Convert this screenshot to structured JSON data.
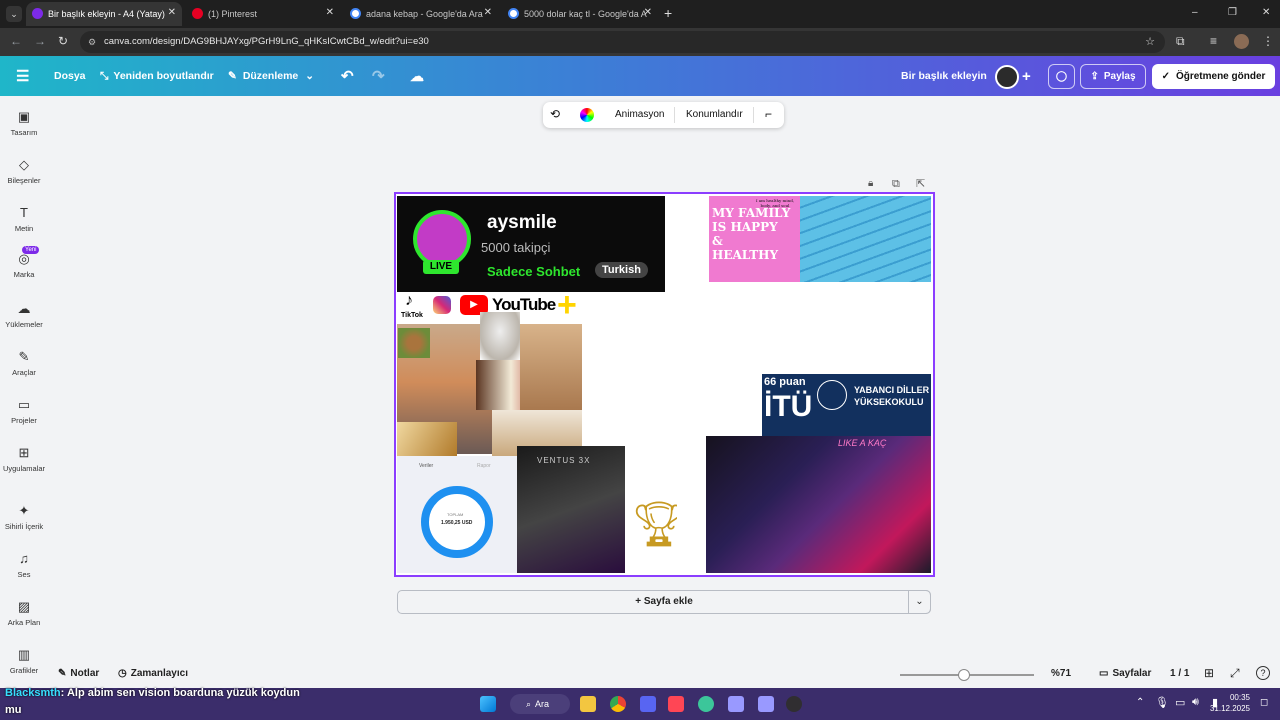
{
  "browser": {
    "tabs": [
      {
        "title": "Bir başlık ekleyin - A4 (Yatay)",
        "active": true,
        "favicon_color": "#7d2ae8"
      },
      {
        "title": "(1) Pinterest",
        "active": false,
        "favicon_color": "#e60023"
      },
      {
        "title": "adana kebap - Google'da Ara",
        "active": false,
        "favicon_color": "#4285f4"
      },
      {
        "title": "5000 dolar kaç tl - Google'da A",
        "active": false,
        "favicon_color": "#4285f4"
      }
    ],
    "new_tab": "+",
    "url": "canva.com/design/DAG9BHJAYxg/PGrH9LnG_qHKsICwtCBd_w/edit?ui=e30",
    "window_controls": [
      "–",
      "❐",
      "✕"
    ]
  },
  "header": {
    "menu_icon": "menu-icon",
    "file": "Dosya",
    "resize": "Yeniden boyutlandır",
    "edit": "Düzenleme",
    "title": "Bir başlık ekleyin",
    "share": "Paylaş",
    "send_teacher": "Öğretmene gönder"
  },
  "rail": [
    {
      "label": "Tasarım",
      "icon": "design-icon",
      "glyph": "▣"
    },
    {
      "label": "Bileşenler",
      "icon": "elements-icon",
      "glyph": "◇"
    },
    {
      "label": "Metin",
      "icon": "text-icon",
      "glyph": "T"
    },
    {
      "label": "Marka",
      "icon": "brand-icon",
      "glyph": "◎",
      "badge": "Yeni"
    },
    {
      "label": "Yüklemeler",
      "icon": "upload-icon",
      "glyph": "☁"
    },
    {
      "label": "Araçlar",
      "icon": "tools-icon",
      "glyph": "✎"
    },
    {
      "label": "Projeler",
      "icon": "folder-icon",
      "glyph": "▭"
    },
    {
      "label": "Uygulamalar",
      "icon": "apps-icon",
      "glyph": "⊞"
    },
    {
      "label": "Sihirli İçerik",
      "icon": "magic-icon",
      "glyph": "✦"
    },
    {
      "label": "Ses",
      "icon": "music-icon",
      "glyph": "♫"
    },
    {
      "label": "Arka Plan",
      "icon": "background-icon",
      "glyph": "▨"
    },
    {
      "label": "Grafikler",
      "icon": "charts-icon",
      "glyph": "▥"
    }
  ],
  "context_toolbar": {
    "animation": "Animasyon",
    "position": "Konumlandır"
  },
  "canvas": {
    "profile_card": {
      "name": "aysmile",
      "followers": "5000 takipçi",
      "chat": "Sadece Sohbet",
      "lang": "Turkish",
      "live": "LIVE"
    },
    "tiktok": "TikTok",
    "youtube": "YouTube",
    "family": "MY FAMILY IS HAPPY & HEALTHY",
    "family_small": "I am healthy mind, body, and soul",
    "itu_score": "66 puan",
    "itu": "İTÜ",
    "itu_school": "YABANCI DİLLER YÜKSEKOKULU",
    "finance_header_a": "Veriler",
    "finance_header_b": "Rapor",
    "finance_label": "TOPLAM",
    "finance_amount": "1.950,25 USD",
    "gpu_brand": "VENTUS 3X",
    "concert_text": "LIKE A KAÇ"
  },
  "add_page": "+ Sayfa ekle",
  "footer": {
    "notes": "Notlar",
    "timer": "Zamanlayıcı",
    "zoom": "%71",
    "zoom_fraction": 0.48,
    "pages": "Sayfalar",
    "page_count": "1 / 1"
  },
  "chat_overlay": {
    "user": "Blacksmth",
    "message": ": Alp abim sen vision boarduna yüzük koydun mu"
  },
  "taskbar": {
    "search": "Ara",
    "time": "00:35",
    "date": "31.12.2025"
  }
}
